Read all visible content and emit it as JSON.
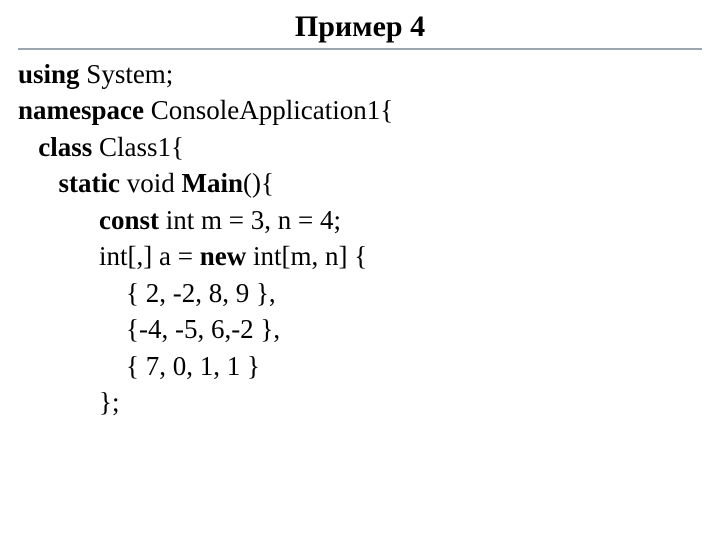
{
  "title": "Пример 4",
  "code": {
    "l1a": "using",
    "l1b": " System;",
    "l2a": "namespace",
    "l2b": " ConsoleApplication1{",
    "l3a": "   class",
    "l3b": " Class1{",
    "l4a": "      static",
    "l4b": " void ",
    "l4c": "Main",
    "l4d": "(){",
    "l5a": "            const",
    "l5b": " int m = 3, n = 4;",
    "l6a": "            int[,] a = ",
    "l6b": "new",
    "l6c": " int[m, n] {",
    "l7": "                { 2, -2, 8, 9 },",
    "l8": "                {-4, -5, 6,-2 },",
    "l9": "                { 7, 0, 1, 1 }",
    "l10": "            };"
  }
}
